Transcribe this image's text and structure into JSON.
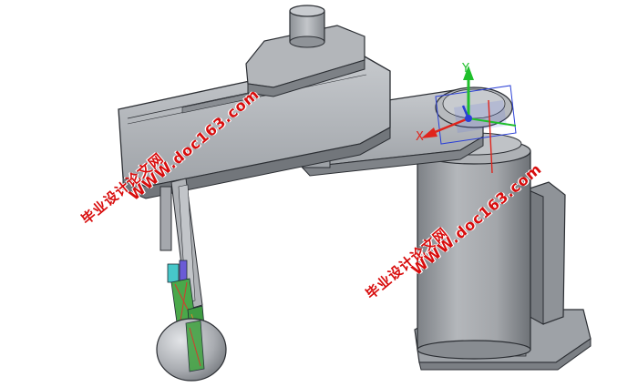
{
  "watermarks": {
    "left_cn": "毕业设计论文网",
    "left_url": "WWW.doc163.com",
    "right_cn": "毕业设计论文网",
    "right_url": "WWW.doc163.com"
  },
  "triad": {
    "y_label": "Y",
    "x_label": "X",
    "colors": {
      "y": "#1fbf2b",
      "x": "#e0241c",
      "z": "#2a3fd6"
    }
  },
  "colors": {
    "body": "#9a9ea3",
    "body_dark": "#6f7378",
    "body_light": "#c3c6ca",
    "outline": "#2b2e33",
    "watermark": "#d80d0d"
  }
}
